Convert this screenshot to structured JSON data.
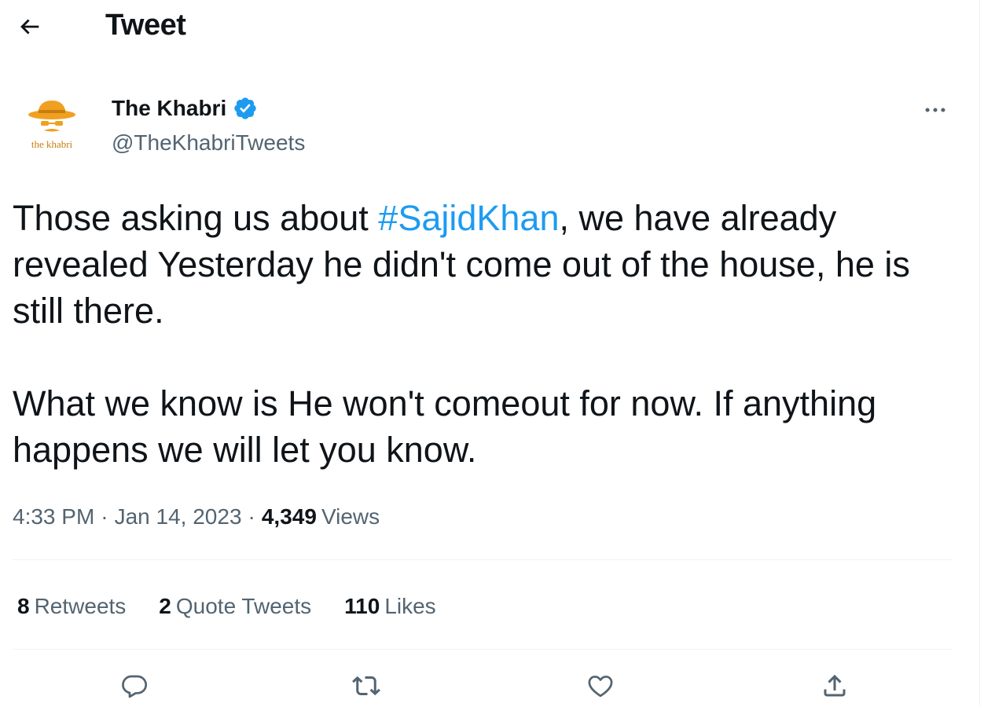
{
  "header": {
    "back_icon": "arrow-left-icon",
    "title": "Tweet"
  },
  "author": {
    "avatar_text": "the khabri",
    "display_name": "The Khabri",
    "verified_icon": "verified-badge-icon",
    "handle": "@TheKhabriTweets",
    "more_icon": "more-horizontal-icon"
  },
  "tweet": {
    "paragraph1": {
      "before": "Those asking us about ",
      "hashtag": "#SajidKhan",
      "after": ", we have already revealed Yesterday he didn't come out of the house, he is still there."
    },
    "paragraph2": "What we know is He won't comeout for now. If anything happens we will let you know.",
    "time": "4:33 PM",
    "separator": "·",
    "date": "Jan 14, 2023",
    "views_count": "4,349",
    "views_label": "Views"
  },
  "stats": {
    "retweets_count": "8",
    "retweets_label": "Retweets",
    "quotes_count": "2",
    "quotes_label": "Quote Tweets",
    "likes_count": "110",
    "likes_label": "Likes"
  },
  "actions": {
    "reply_icon": "reply-icon",
    "retweet_icon": "retweet-icon",
    "like_icon": "heart-icon",
    "share_icon": "share-icon"
  },
  "colors": {
    "text": "#0f1419",
    "secondary": "#536471",
    "link": "#1d9bf0",
    "divider": "#eff3f4",
    "logo_orange": "#f0a020"
  }
}
